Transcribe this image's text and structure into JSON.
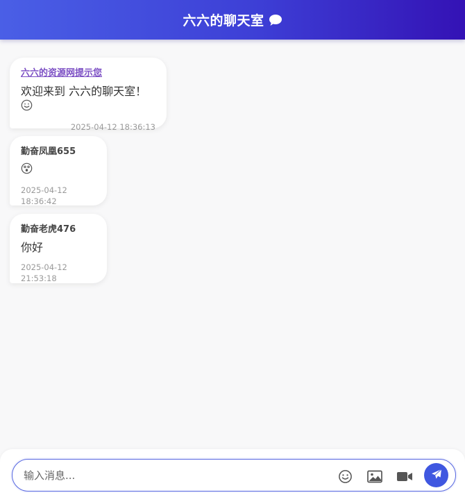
{
  "header": {
    "title": "六六的聊天室",
    "icon": "chat-bubble-icon"
  },
  "messages": [
    {
      "sender": "六六的资源网提示您",
      "text": "欢迎来到 六六的聊天室！",
      "emoji": "smile-icon",
      "time": "2025-04-12 18:36:13",
      "system": true
    },
    {
      "sender": "勤奋凤凰655",
      "text": "",
      "emoji": "surprised-face-icon",
      "time": "2025-04-12 18:36:42"
    },
    {
      "sender": "勤奋老虎476",
      "text": "你好",
      "time": "2025-04-12 21:53:18"
    }
  ],
  "composer": {
    "placeholder": "输入消息...",
    "value": "",
    "tools": [
      "emoji-icon",
      "image-icon",
      "video-icon"
    ],
    "send_icon": "send-icon"
  },
  "colors": {
    "accent": "#3f57e0",
    "header_start": "#4a5fe6",
    "header_end": "#3412b5",
    "system_sender": "#7c4fc4"
  }
}
